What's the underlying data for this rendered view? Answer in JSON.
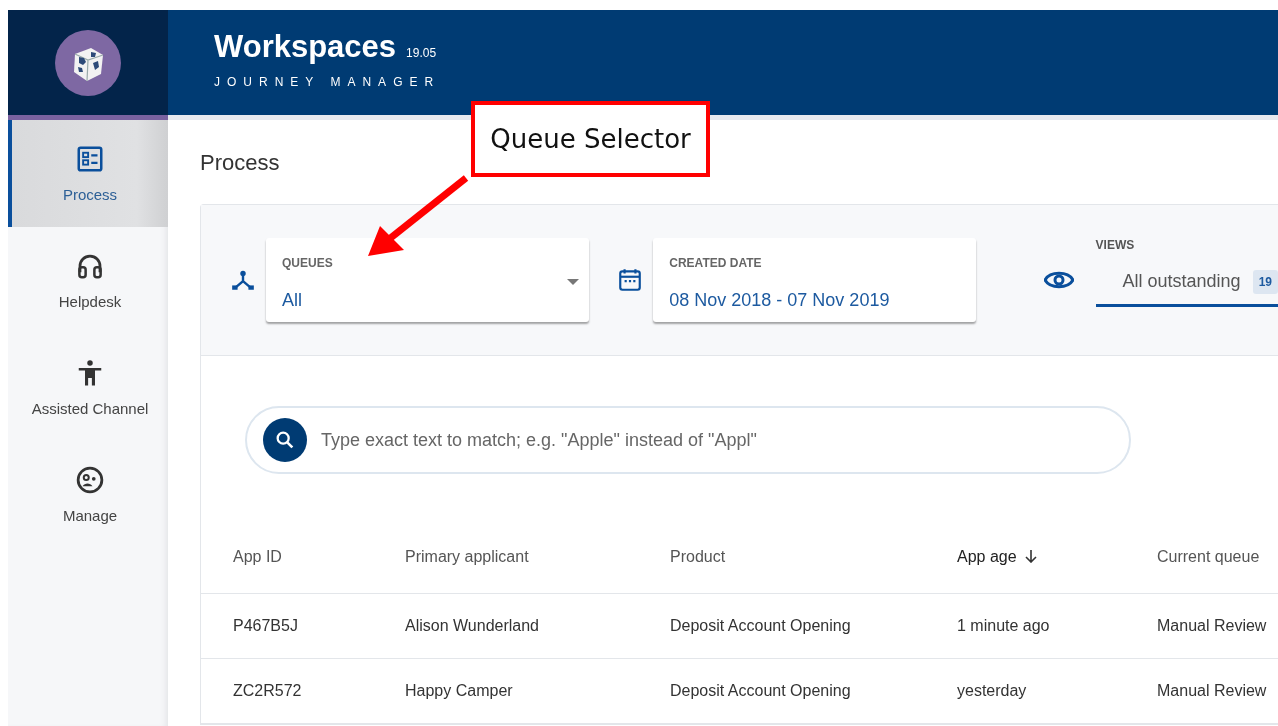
{
  "app": {
    "title": "Workspaces",
    "version": "19.05",
    "subtitle": "JOURNEY MANAGER"
  },
  "sidebar": {
    "items": [
      {
        "label": "Process",
        "kind": "process",
        "selected": true
      },
      {
        "label": "Helpdesk",
        "kind": "helpdesk",
        "selected": false
      },
      {
        "label": "Assisted Channel",
        "kind": "assisted",
        "selected": false
      },
      {
        "label": "Manage",
        "kind": "manage",
        "selected": false
      }
    ]
  },
  "page": {
    "title": "Process"
  },
  "filters": {
    "queues": {
      "label": "QUEUES",
      "value": "All"
    },
    "created_date": {
      "label": "CREATED DATE",
      "value": "08 Nov 2018 - 07 Nov 2019"
    },
    "views": {
      "label": "VIEWS",
      "tabs": [
        {
          "label": "All outstanding",
          "count": "19",
          "selected": true
        }
      ]
    }
  },
  "search": {
    "placeholder": "Type exact text to match; e.g. \"Apple\" instead of \"Appl\""
  },
  "table": {
    "columns": [
      {
        "label": "App ID",
        "sorted": false
      },
      {
        "label": "Primary applicant",
        "sorted": false
      },
      {
        "label": "Product",
        "sorted": false
      },
      {
        "label": "App age",
        "sorted": true
      },
      {
        "label": "Current queue",
        "sorted": false
      }
    ],
    "rows": [
      [
        "P467B5J",
        "Alison Wunderland",
        "Deposit Account Opening",
        "1 minute ago",
        "Manual Review"
      ],
      [
        "ZC2R572",
        "Happy Camper",
        "Deposit Account Opening",
        "yesterday",
        "Manual Review"
      ]
    ]
  },
  "annotation": {
    "label": "Queue Selector"
  }
}
